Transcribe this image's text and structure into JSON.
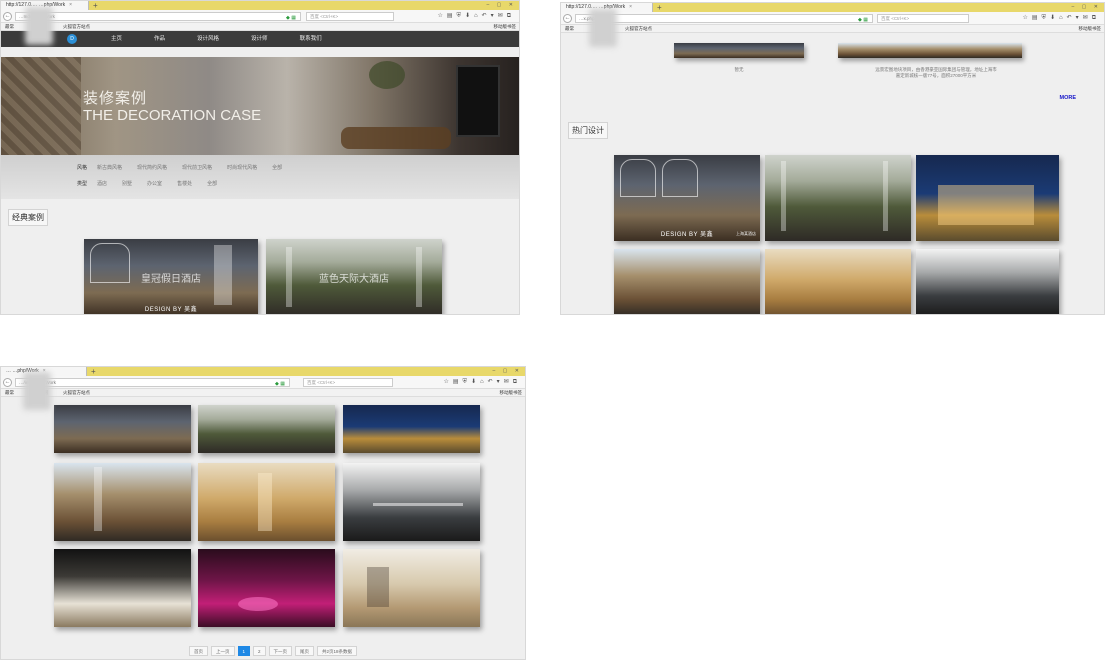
{
  "browser": {
    "tab1_title": "http://127.0.… …php/Work",
    "tab2_title": "http://127.0.… …php/Work",
    "tab3_title": "… …php/Work",
    "url1": "…Index.php/Work",
    "url2": "…x.php/Work",
    "url3": "…/index.php/Work",
    "search_placeholder": "百度 <Ctrl+K>",
    "bookmark_1": "最常",
    "bookmark_2": "火狐官方站点",
    "bookmark_3": "上网",
    "bookmark_right": "移动版书签",
    "new_tab_icon": "plus-icon",
    "close_icon": "close-icon"
  },
  "site": {
    "logo_text": "D",
    "menu": [
      "主页",
      "作品",
      "设计风格",
      "设计师",
      "联系我们"
    ]
  },
  "banner": {
    "title_zh": "装修案例",
    "title_en": "THE DECORATION CASE"
  },
  "filters": {
    "style_label": "风格",
    "styles": [
      "新古典风格",
      "现代简约风格",
      "现代前卫风格",
      "时尚现代风格",
      "全部"
    ],
    "type_label": "类型",
    "types": [
      "酒店",
      "别墅",
      "办公室",
      "售楼处",
      "全部"
    ]
  },
  "sections": {
    "classic_cases": "经典案例",
    "hot_designs": "热门设计",
    "more": "MORE"
  },
  "captions": {
    "left": "暂无",
    "right_line1": "远景宏图地块项目，由香港豪亚国际集团与管理，地址上海市",
    "right_line2": "嘉定新城核一版77号，面积27000平方米"
  },
  "cards": {
    "classic_1_title": "皇冠假日酒店",
    "classic_1_by": "DESIGN BY 吴鑫",
    "classic_2_title": "蓝色天际大酒店",
    "hot_1_by": "DESIGN BY 吴鑫",
    "hot_1_label": "上海某酒店"
  },
  "pagination": [
    "首页",
    "上一页",
    "1",
    "2",
    "下一页",
    "尾页",
    "共2页18条数据"
  ]
}
